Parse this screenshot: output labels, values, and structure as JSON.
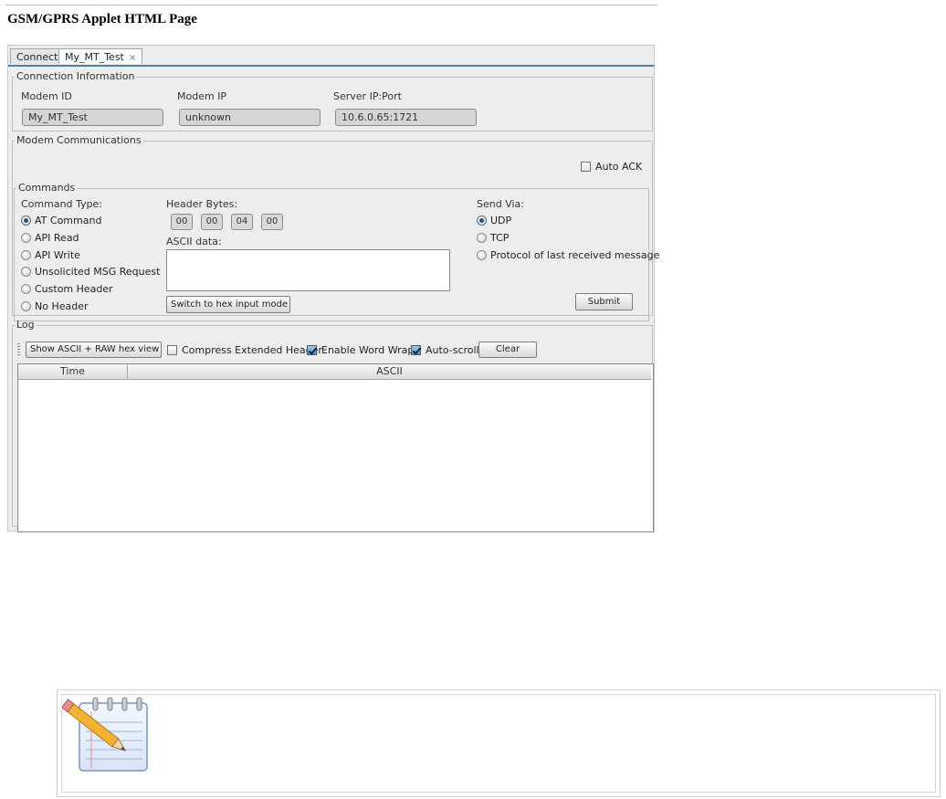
{
  "page": {
    "heading": "GSM/GPRS Applet HTML Page"
  },
  "tabs": [
    {
      "label": "Connect"
    },
    {
      "label": "My_MT_Test",
      "close": "×"
    }
  ],
  "connection": {
    "legend": "Connection Information",
    "modem_id_label": "Modem ID",
    "modem_id_value": "My_MT_Test",
    "modem_ip_label": "Modem IP",
    "modem_ip_value": "unknown",
    "server_label": "Server IP:Port",
    "server_value": "10.6.0.65:1721"
  },
  "communications": {
    "legend": "Modem Communications",
    "auto_ack_label": "Auto ACK",
    "auto_ack_checked": false
  },
  "commands": {
    "legend": "Commands",
    "command_type_label": "Command Type:",
    "command_types": [
      {
        "label": "AT Command",
        "selected": true
      },
      {
        "label": "API Read",
        "selected": false
      },
      {
        "label": "API Write",
        "selected": false
      },
      {
        "label": "Unsolicited MSG Request",
        "selected": false
      },
      {
        "label": "Custom Header",
        "selected": false
      },
      {
        "label": "No Header",
        "selected": false
      }
    ],
    "header_bytes_label": "Header Bytes:",
    "header_bytes": [
      "00",
      "00",
      "04",
      "00"
    ],
    "ascii_label": "ASCII data:",
    "ascii_value": "",
    "switch_button": "Switch to hex input mode",
    "send_via_label": "Send Via:",
    "send_via": [
      {
        "label": "UDP",
        "selected": true
      },
      {
        "label": "TCP",
        "selected": false
      },
      {
        "label": "Protocol of last received message",
        "selected": false
      }
    ],
    "submit_button": "Submit"
  },
  "log": {
    "legend": "Log",
    "show_view_button": "Show ASCII + RAW hex view",
    "compress_label": "Compress Extended Header",
    "compress_checked": false,
    "word_wrap_label": "Enable Word Wrap",
    "word_wrap_checked": true,
    "autoscroll_label": "Auto-scroll",
    "autoscroll_checked": true,
    "clear_button": "Clear",
    "columns": [
      "Time",
      "ASCII"
    ],
    "rows": []
  },
  "note": {
    "icon": "notepad-pencil-icon"
  }
}
